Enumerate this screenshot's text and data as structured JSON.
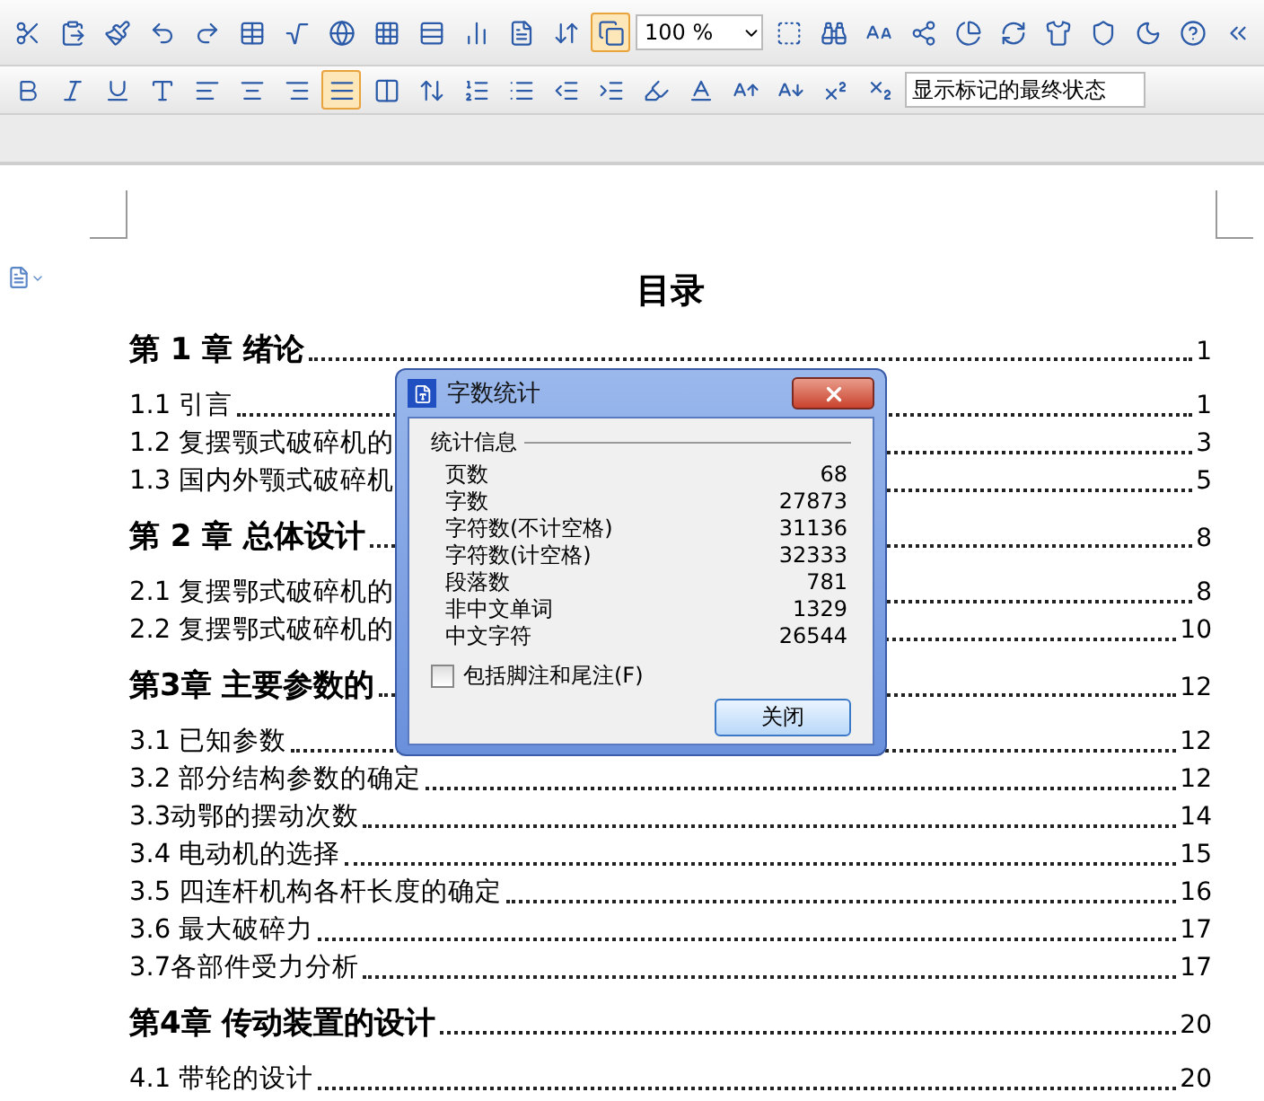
{
  "toolbar_top": {
    "buttons": [
      {
        "selected": false
      },
      {
        "selected": false
      },
      {
        "selected": false
      },
      {
        "selected": false
      },
      {
        "selected": false
      },
      {
        "selected": false
      },
      {
        "selected": false
      },
      {
        "selected": false
      },
      {
        "selected": false
      },
      {
        "selected": false
      },
      {
        "selected": false
      },
      {
        "selected": false
      },
      {
        "selected": false
      },
      {
        "selected": true
      }
    ],
    "zoom": "100 %",
    "buttons_after": [
      {
        "selected": false
      },
      {
        "selected": false
      },
      {
        "selected": false
      },
      {
        "selected": false
      },
      {
        "selected": false
      },
      {
        "selected": false
      },
      {
        "selected": false
      },
      {
        "selected": false
      },
      {
        "selected": false
      },
      {
        "selected": false
      },
      {
        "selected": false
      }
    ]
  },
  "toolbar_format": {
    "buttons": [
      {
        "selected": false
      },
      {
        "selected": false
      },
      {
        "selected": false
      },
      {
        "selected": false
      },
      {
        "selected": false
      },
      {
        "selected": false
      },
      {
        "selected": false
      },
      {
        "selected": true
      },
      {
        "selected": false
      },
      {
        "selected": false
      },
      {
        "selected": false
      },
      {
        "selected": false
      },
      {
        "selected": false
      },
      {
        "selected": false
      },
      {
        "selected": false
      },
      {
        "selected": false
      },
      {
        "selected": false
      },
      {
        "selected": false
      },
      {
        "selected": false
      },
      {
        "selected": false
      }
    ],
    "markup_mode": "显示标记的最终状态"
  },
  "document": {
    "title": "目录",
    "toc": [
      {
        "kind": "chapter",
        "text": "第 1 章 绪论",
        "page": "1"
      },
      {
        "kind": "section",
        "text": "1.1 引言",
        "page": "1"
      },
      {
        "kind": "section",
        "text": "1.2 复摆颚式破碎机的",
        "page": "3"
      },
      {
        "kind": "section",
        "text": "1.3 国内外颚式破碎机",
        "page": "5"
      },
      {
        "kind": "chapter",
        "text": "第 2 章 总体设计",
        "page": "8"
      },
      {
        "kind": "section",
        "text": "2.1 复摆鄂式破碎机的",
        "page": "8"
      },
      {
        "kind": "section",
        "text": "2.2 复摆鄂式破碎机的",
        "page": "10"
      },
      {
        "kind": "chapter",
        "text": "第3章  主要参数的",
        "page": "12"
      },
      {
        "kind": "section",
        "text": "3.1 已知参数",
        "page": "12"
      },
      {
        "kind": "section",
        "text": "3.2 部分结构参数的确定",
        "page": "12"
      },
      {
        "kind": "section",
        "text": "3.3动鄂的摆动次数",
        "page": "14"
      },
      {
        "kind": "section",
        "text": "3.4 电动机的选择",
        "page": "15"
      },
      {
        "kind": "section",
        "text": "3.5 四连杆机构各杆长度的确定",
        "page": "16"
      },
      {
        "kind": "section",
        "text": "3.6 最大破碎力",
        "page": "17"
      },
      {
        "kind": "section",
        "text": "3.7各部件受力分析",
        "page": "17"
      },
      {
        "kind": "chapter",
        "text": "第4章  传动装置的设计",
        "page": "20"
      },
      {
        "kind": "section",
        "text": "4.1 带轮的设计",
        "page": "20"
      }
    ]
  },
  "dialog": {
    "title": "字数统计",
    "group": "统计信息",
    "stats": [
      {
        "label": "页数",
        "value": "68"
      },
      {
        "label": "字数",
        "value": "27873"
      },
      {
        "label": "字符数(不计空格)",
        "value": "31136"
      },
      {
        "label": "字符数(计空格)",
        "value": "32333"
      },
      {
        "label": "段落数",
        "value": "781"
      },
      {
        "label": "非中文单词",
        "value": "1329"
      },
      {
        "label": "中文字符",
        "value": "26544"
      }
    ],
    "checkbox": {
      "label": "包括脚注和尾注(F)",
      "checked": false
    },
    "button": "关闭"
  }
}
